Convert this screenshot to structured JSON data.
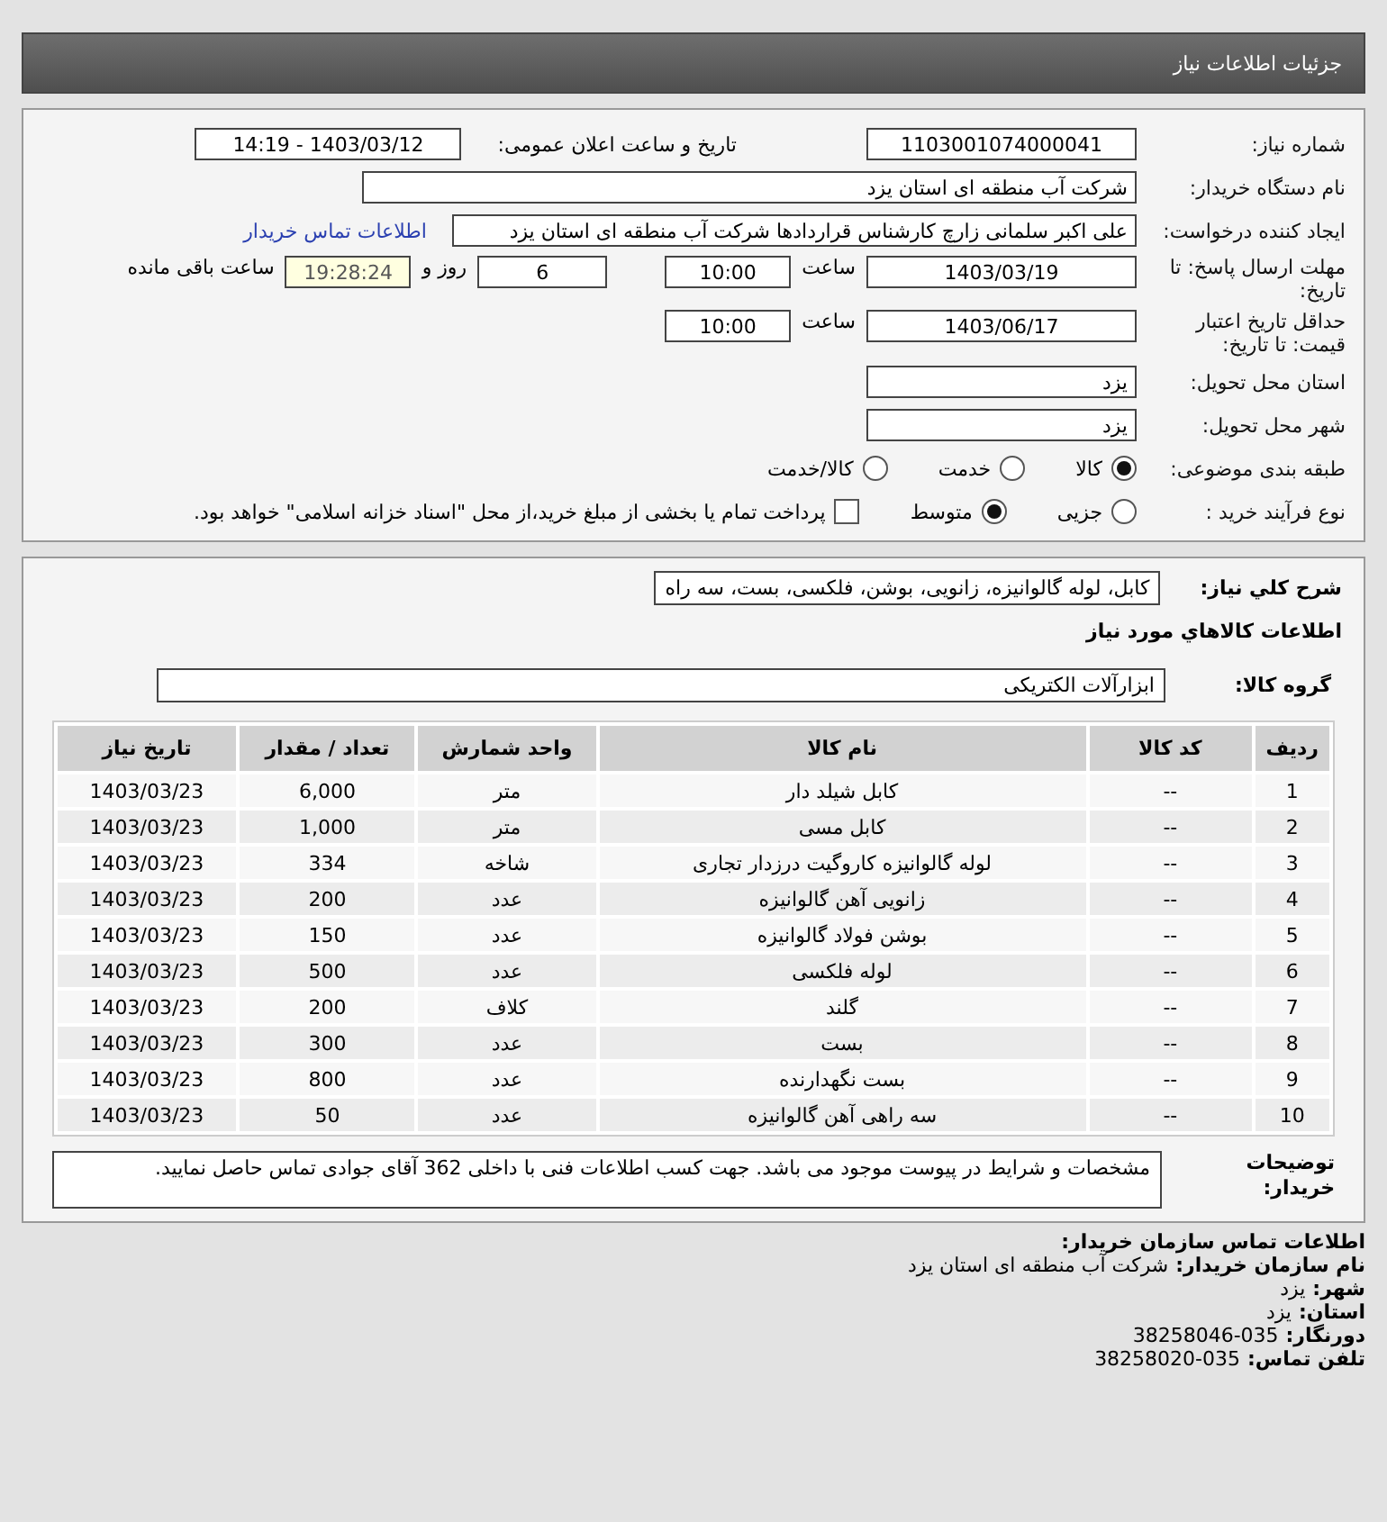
{
  "header": {
    "title": "جزئیات اطلاعات نیاز"
  },
  "details": {
    "need_number": {
      "label": "شماره نیاز:",
      "value": "1103001074000041"
    },
    "announce": {
      "label": "تاریخ و ساعت اعلان عمومی:",
      "value": "1403/03/12 - 14:19"
    },
    "buyer": {
      "label": "نام دستگاه خریدار:",
      "value": "شرکت آب منطقه ای استان یزد"
    },
    "creator": {
      "label": "ایجاد کننده درخواست:",
      "value": "علی اکبر سلمانی زارچ کارشناس قراردادها شرکت آب منطقه ای استان یزد",
      "link": "اطلاعات تماس خریدار"
    },
    "deadline": {
      "label": "مهلت ارسال پاسخ: تا تاریخ:",
      "date": "1403/03/19",
      "time_label": "ساعت",
      "time": "10:00",
      "days": "6",
      "days_label": "روز و",
      "remaining": "19:28:24",
      "remaining_label": "ساعت باقی مانده"
    },
    "validity": {
      "label": "حداقل تاریخ اعتبار قیمت: تا تاریخ:",
      "date": "1403/06/17",
      "time_label": "ساعت",
      "time": "10:00"
    },
    "province": {
      "label": "استان محل تحویل:",
      "value": "یزد"
    },
    "city": {
      "label": "شهر محل تحویل:",
      "value": "یزد"
    },
    "category": {
      "label": "طبقه بندی موضوعی:",
      "options": [
        {
          "label": "کالا",
          "selected": true
        },
        {
          "label": "خدمت",
          "selected": false
        },
        {
          "label": "کالا/خدمت",
          "selected": false
        }
      ]
    },
    "process": {
      "label": "نوع فرآیند خرید :",
      "options": [
        {
          "label": "جزیی",
          "selected": false
        },
        {
          "label": "متوسط",
          "selected": true
        }
      ],
      "payment": {
        "checked": false,
        "text": "پرداخت تمام یا بخشی از مبلغ خرید،از محل \"اسناد خزانه اسلامی\" خواهد بود."
      }
    }
  },
  "goods": {
    "summary": {
      "label": "شرح کلي نياز:",
      "value": "کابل، لوله گالوانیزه، زانویی، بوشن، فلکسی، بست، سه راه"
    },
    "title": "اطلاعات کالاهاي مورد نياز",
    "group": {
      "label": "گروه کالا:",
      "value": "ابزارآلات الکتریکی"
    },
    "table": {
      "columns": [
        "ردیف",
        "کد کالا",
        "نام کالا",
        "واحد شمارش",
        "تعداد / مقدار",
        "تاریخ نیاز"
      ],
      "rows": [
        [
          "1",
          "--",
          "کابل شیلد دار",
          "متر",
          "6,000",
          "1403/03/23"
        ],
        [
          "2",
          "--",
          "کابل مسی",
          "متر",
          "1,000",
          "1403/03/23"
        ],
        [
          "3",
          "--",
          "لوله گالوانیزه کاروگیت درزدار تجاری",
          "شاخه",
          "334",
          "1403/03/23"
        ],
        [
          "4",
          "--",
          "زانویی آهن گالوانیزه",
          "عدد",
          "200",
          "1403/03/23"
        ],
        [
          "5",
          "--",
          "بوشن فولاد گالوانیزه",
          "عدد",
          "150",
          "1403/03/23"
        ],
        [
          "6",
          "--",
          "لوله فلکسی",
          "عدد",
          "500",
          "1403/03/23"
        ],
        [
          "7",
          "--",
          "گلند",
          "کلاف",
          "200",
          "1403/03/23"
        ],
        [
          "8",
          "--",
          "بست",
          "عدد",
          "300",
          "1403/03/23"
        ],
        [
          "9",
          "--",
          "بست نگهدارنده",
          "عدد",
          "800",
          "1403/03/23"
        ],
        [
          "10",
          "--",
          "سه راهی آهن گالوانیزه",
          "عدد",
          "50",
          "1403/03/23"
        ]
      ]
    },
    "notes": {
      "label": "توضیحات خریدار:",
      "value": "مشخصات و شرایط در پیوست موجود می باشد. جهت کسب اطلاعات فنی با داخلی 362 آقای جوادی تماس حاصل نمایید."
    }
  },
  "contact": {
    "title": "اطلاعات تماس سازمان خریدار:",
    "lines": [
      {
        "label": "نام سازمان خریدار:",
        "value": "شرکت آب منطقه ای استان یزد"
      },
      {
        "label": "شهر:",
        "value": "یزد"
      },
      {
        "label": "استان:",
        "value": "یزد"
      },
      {
        "label": "دورنگار:",
        "value": "38258046-035"
      },
      {
        "label": "تلفن تماس:",
        "value": "38258020-035"
      }
    ]
  }
}
